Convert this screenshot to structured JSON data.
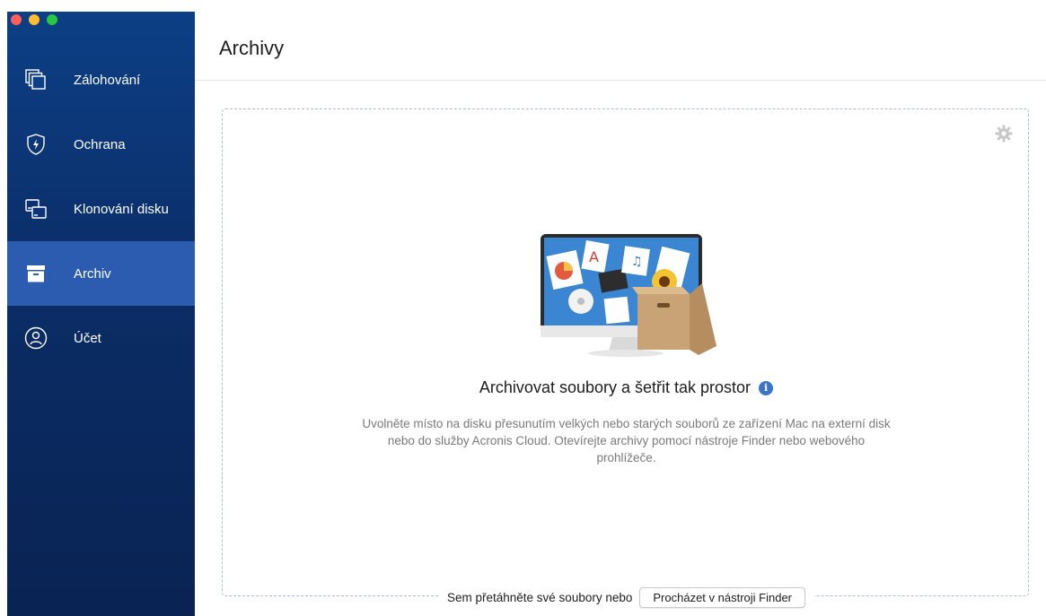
{
  "window": {
    "traffic_lights": [
      "close",
      "minimize",
      "zoom"
    ]
  },
  "sidebar": {
    "items": [
      {
        "label": "Zálohování",
        "icon": "backup-copies-icon"
      },
      {
        "label": "Ochrana",
        "icon": "shield-bolt-icon"
      },
      {
        "label": "Klonování disku",
        "icon": "disk-clone-icon"
      },
      {
        "label": "Archiv",
        "icon": "archive-box-icon",
        "active": true
      },
      {
        "label": "Účet",
        "icon": "account-icon"
      }
    ],
    "colors": {
      "background": "#0b2d66",
      "active": "#2b5cb0"
    }
  },
  "main": {
    "title": "Archivy",
    "dropzone": {
      "heading": "Archivovat soubory a šetřit tak prostor",
      "info_icon": "i",
      "description": "Uvolněte místo na disku přesunutím velkých nebo starých souborů ze zařízení Mac na externí disk nebo do služby Acronis Cloud. Otevírejte archivy pomocí nástroje Finder nebo webového prohlížeče.",
      "drop_hint": "Sem přetáhněte své soubory nebo",
      "finder_button": "Procházet v nástroji Finder"
    }
  }
}
